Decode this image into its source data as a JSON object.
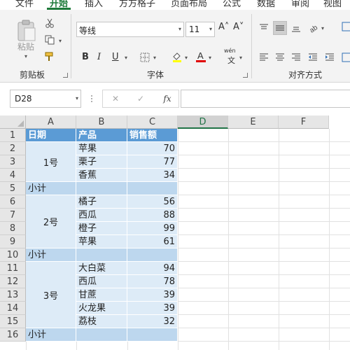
{
  "ribbon_tabs": [
    {
      "label": "文件"
    },
    {
      "label": "开始"
    },
    {
      "label": "插入"
    },
    {
      "label": "方方格子"
    },
    {
      "label": "页面布局"
    },
    {
      "label": "公式"
    },
    {
      "label": "数据"
    },
    {
      "label": "审阅"
    },
    {
      "label": "视图"
    }
  ],
  "ribbon": {
    "clipboard": {
      "paste_label": "粘贴",
      "group_label": "剪贴板"
    },
    "font": {
      "font_name": "等线",
      "font_size": "11",
      "group_label": "字体",
      "bold": "B",
      "italic": "I",
      "underline": "U",
      "grow": "A˄",
      "shrink": "A˅",
      "phonetic": "wén",
      "font_color": "#e00000"
    },
    "alignment": {
      "group_label": "对齐方式"
    }
  },
  "formula_bar": {
    "name_box": "D28",
    "cancel": "✕",
    "enter": "✓",
    "fx": "fx",
    "value": ""
  },
  "columns": [
    "A",
    "B",
    "C",
    "D",
    "E",
    "F"
  ],
  "selected_column": "D",
  "rows": [
    "1",
    "2",
    "3",
    "4",
    "5",
    "6",
    "7",
    "8",
    "9",
    "10",
    "11",
    "12",
    "13",
    "14",
    "15",
    "16"
  ],
  "table": {
    "headers": [
      "日期",
      "产品",
      "销售额"
    ],
    "groups": [
      {
        "date": "1号",
        "items": [
          [
            "苹果",
            "70"
          ],
          [
            "栗子",
            "77"
          ],
          [
            "香蕉",
            "34"
          ]
        ],
        "subtotal": "小计"
      },
      {
        "date": "2号",
        "items": [
          [
            "橘子",
            "56"
          ],
          [
            "西瓜",
            "88"
          ],
          [
            "橙子",
            "99"
          ],
          [
            "苹果",
            "61"
          ]
        ],
        "subtotal": "小计"
      },
      {
        "date": "3号",
        "items": [
          [
            "大白菜",
            "94"
          ],
          [
            "西瓜",
            "78"
          ],
          [
            "甘蔗",
            "39"
          ],
          [
            "火龙果",
            "39"
          ],
          [
            "荔枝",
            "32"
          ]
        ],
        "subtotal": "小计"
      }
    ]
  },
  "colors": {
    "accent": "#217346",
    "header_fill": "#5b9bd5",
    "data_fill": "#ddebf7",
    "subtotal_fill": "#bdd7ee"
  }
}
